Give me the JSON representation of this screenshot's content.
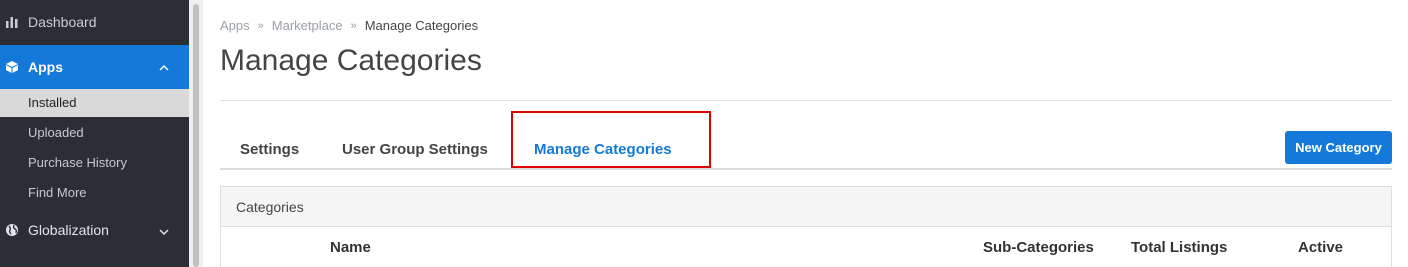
{
  "sidebar": {
    "dashboard_label": "Dashboard",
    "apps_label": "Apps",
    "apps_sub": [
      "Installed",
      "Uploaded",
      "Purchase History",
      "Find More"
    ],
    "globalization_label": "Globalization"
  },
  "breadcrumb": {
    "items": [
      "Apps",
      "Marketplace",
      "Manage Categories"
    ]
  },
  "page": {
    "title": "Manage Categories"
  },
  "tabs": [
    {
      "label": "Settings",
      "active": false
    },
    {
      "label": "User Group Settings",
      "active": false
    },
    {
      "label": "Manage Categories",
      "active": true
    }
  ],
  "toolbar": {
    "new_category_label": "New Category"
  },
  "panel": {
    "title": "Categories",
    "columns": [
      "Name",
      "Sub-Categories",
      "Total Listings",
      "Active"
    ]
  },
  "colors": {
    "accent": "#1479d8",
    "sidebar_bg": "#2b2e33",
    "highlight": "#e00000"
  },
  "icons": {
    "dashboard": "bar-chart-icon",
    "apps": "cube-icon",
    "globalization": "globe-icon"
  }
}
